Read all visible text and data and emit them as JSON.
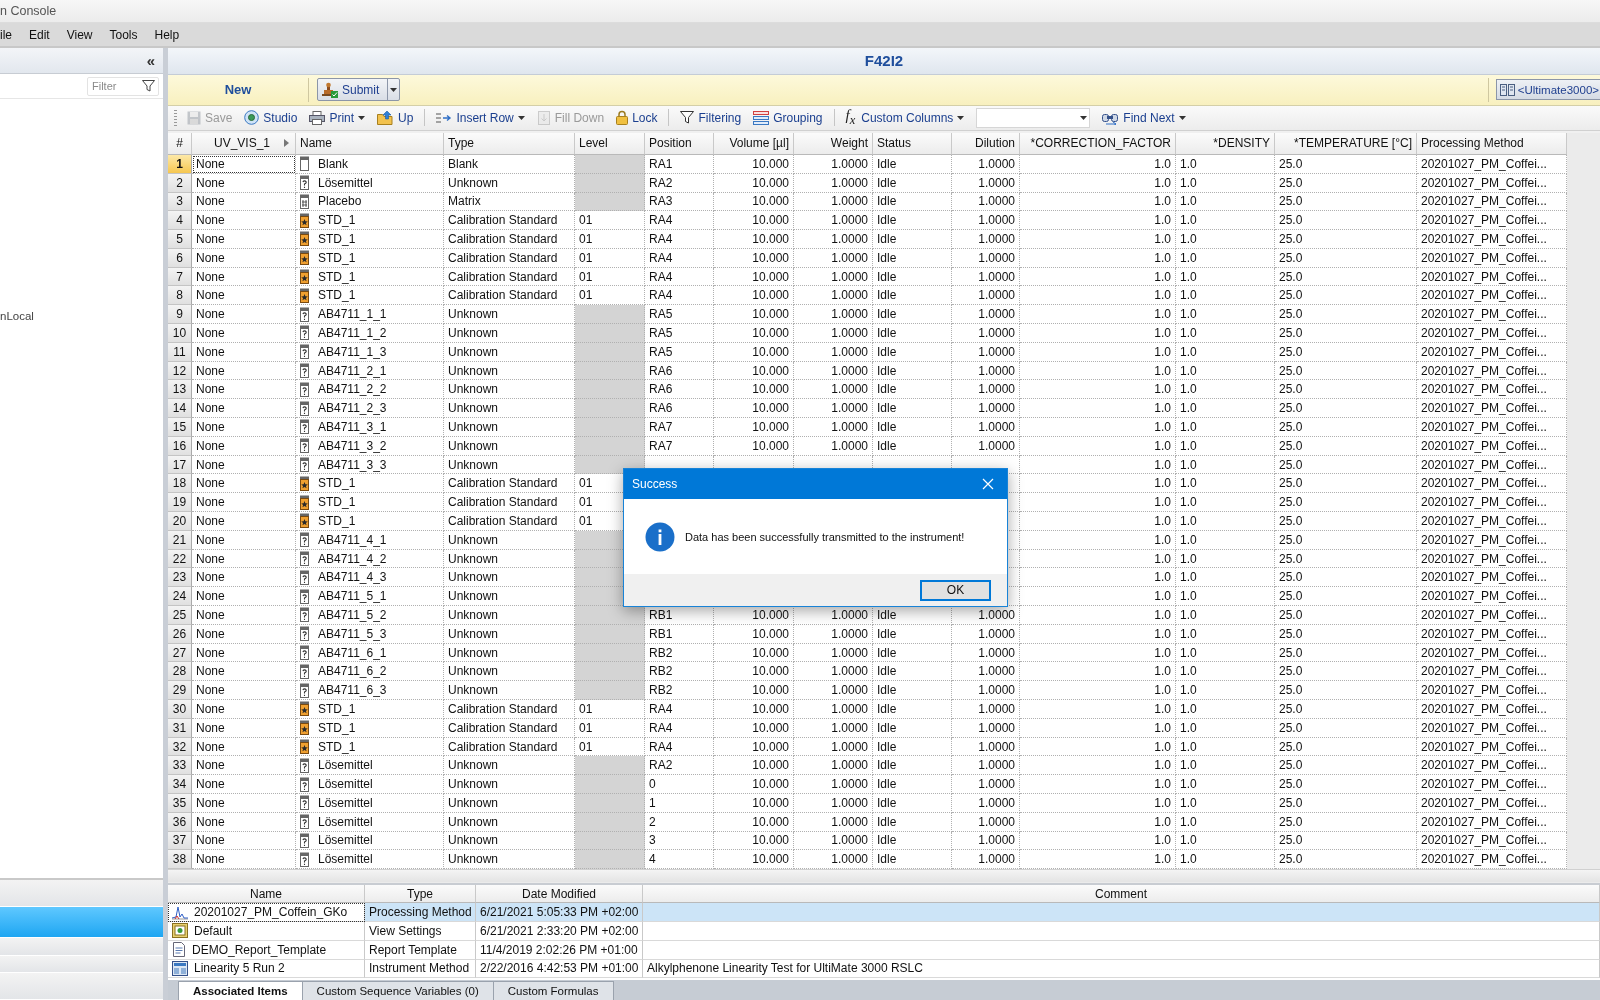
{
  "window": {
    "title": "n Console"
  },
  "menu": [
    "ile",
    "Edit",
    "View",
    "Tools",
    "Help"
  ],
  "sidebar": {
    "collapse": "«",
    "filter": {
      "placeholder": "Filter"
    },
    "items": [
      {
        "label": "nLocal"
      }
    ],
    "lower_items": [
      {
        "selected": false
      },
      {
        "selected": true
      },
      {
        "selected": false
      },
      {
        "selected": false
      },
      {
        "selected": false
      }
    ]
  },
  "document": {
    "title": "F42I2"
  },
  "action_bar": {
    "mode": "New",
    "submit": {
      "label": "Submit"
    },
    "instrument_button": {
      "label": "<Ultimate3000>"
    }
  },
  "toolbar": [
    {
      "label": "Save",
      "kind": "button",
      "disabled": true,
      "separator_before": false
    },
    {
      "label": "Studio",
      "kind": "button",
      "disabled": false,
      "separator_before": false
    },
    {
      "label": "Print",
      "kind": "dropdown",
      "disabled": false,
      "separator_before": false
    },
    {
      "label": "Up",
      "kind": "button",
      "disabled": false,
      "separator_before": false
    },
    {
      "label": "Insert Row",
      "kind": "dropdown",
      "disabled": false,
      "separator_before": true
    },
    {
      "label": "Fill Down",
      "kind": "button",
      "disabled": true,
      "separator_before": false
    },
    {
      "label": "Lock",
      "kind": "button",
      "disabled": false,
      "separator_before": false
    },
    {
      "label": "Filtering",
      "kind": "button",
      "disabled": false,
      "separator_before": true
    },
    {
      "label": "Grouping",
      "kind": "button",
      "disabled": false,
      "separator_before": false
    },
    {
      "label": "Custom Columns",
      "symbol": "f$_{x}$",
      "kind": "dropdown",
      "disabled": false,
      "separator_before": true
    },
    {
      "kind": "combo",
      "disabled": false,
      "separator_before": false
    },
    {
      "label": "Find Next",
      "kind": "dropdown",
      "disabled": false,
      "separator_before": false
    }
  ],
  "table": {
    "number_header": "#",
    "columns": [
      "UV_VIS_1",
      "Name",
      "Type",
      "Level",
      "Position",
      "Volume [µl]",
      "Weight",
      "Status",
      "Dilution",
      "*CORRECTION_FACTOR",
      "*DENSITY",
      "*TEMPERATURE [°C]",
      "Processing Method"
    ],
    "rows": [
      {
        "number": "1",
        "selected": true,
        "kind": "blank",
        "level_disabled": true,
        "cells": [
          "None",
          "Blank",
          "Blank",
          null,
          "RA1",
          "10.000",
          "1.0000",
          "Idle",
          "1.0000",
          "1.0",
          "1.0",
          "25.0",
          "20201027_PM_Coffei..."
        ]
      },
      {
        "number": "2",
        "selected": false,
        "kind": "unknown",
        "level_disabled": true,
        "cells": [
          "None",
          "Lösemittel",
          "Unknown",
          null,
          "RA2",
          "10.000",
          "1.0000",
          "Idle",
          "1.0000",
          "1.0",
          "1.0",
          "25.0",
          "20201027_PM_Coffei..."
        ]
      },
      {
        "number": "3",
        "selected": false,
        "kind": "matrix",
        "level_disabled": true,
        "cells": [
          "None",
          "Placebo",
          "Matrix",
          null,
          "RA3",
          "10.000",
          "1.0000",
          "Idle",
          "1.0000",
          "1.0",
          "1.0",
          "25.0",
          "20201027_PM_Coffei..."
        ]
      },
      {
        "number": "4",
        "selected": false,
        "kind": "standard",
        "level_disabled": false,
        "cells": [
          "None",
          "STD_1",
          "Calibration Standard",
          "01",
          "RA4",
          "10.000",
          "1.0000",
          "Idle",
          "1.0000",
          "1.0",
          "1.0",
          "25.0",
          "20201027_PM_Coffei..."
        ]
      },
      {
        "number": "5",
        "selected": false,
        "kind": "standard",
        "level_disabled": false,
        "cells": [
          "None",
          "STD_1",
          "Calibration Standard",
          "01",
          "RA4",
          "10.000",
          "1.0000",
          "Idle",
          "1.0000",
          "1.0",
          "1.0",
          "25.0",
          "20201027_PM_Coffei..."
        ]
      },
      {
        "number": "6",
        "selected": false,
        "kind": "standard",
        "level_disabled": false,
        "cells": [
          "None",
          "STD_1",
          "Calibration Standard",
          "01",
          "RA4",
          "10.000",
          "1.0000",
          "Idle",
          "1.0000",
          "1.0",
          "1.0",
          "25.0",
          "20201027_PM_Coffei..."
        ]
      },
      {
        "number": "7",
        "selected": false,
        "kind": "standard",
        "level_disabled": false,
        "cells": [
          "None",
          "STD_1",
          "Calibration Standard",
          "01",
          "RA4",
          "10.000",
          "1.0000",
          "Idle",
          "1.0000",
          "1.0",
          "1.0",
          "25.0",
          "20201027_PM_Coffei..."
        ]
      },
      {
        "number": "8",
        "selected": false,
        "kind": "standard",
        "level_disabled": false,
        "cells": [
          "None",
          "STD_1",
          "Calibration Standard",
          "01",
          "RA4",
          "10.000",
          "1.0000",
          "Idle",
          "1.0000",
          "1.0",
          "1.0",
          "25.0",
          "20201027_PM_Coffei..."
        ]
      },
      {
        "number": "9",
        "selected": false,
        "kind": "unknown",
        "level_disabled": true,
        "cells": [
          "None",
          "AB4711_1_1",
          "Unknown",
          null,
          "RA5",
          "10.000",
          "1.0000",
          "Idle",
          "1.0000",
          "1.0",
          "1.0",
          "25.0",
          "20201027_PM_Coffei..."
        ]
      },
      {
        "number": "10",
        "selected": false,
        "kind": "unknown",
        "level_disabled": true,
        "cells": [
          "None",
          "AB4711_1_2",
          "Unknown",
          null,
          "RA5",
          "10.000",
          "1.0000",
          "Idle",
          "1.0000",
          "1.0",
          "1.0",
          "25.0",
          "20201027_PM_Coffei..."
        ]
      },
      {
        "number": "11",
        "selected": false,
        "kind": "unknown",
        "level_disabled": true,
        "cells": [
          "None",
          "AB4711_1_3",
          "Unknown",
          null,
          "RA5",
          "10.000",
          "1.0000",
          "Idle",
          "1.0000",
          "1.0",
          "1.0",
          "25.0",
          "20201027_PM_Coffei..."
        ]
      },
      {
        "number": "12",
        "selected": false,
        "kind": "unknown",
        "level_disabled": true,
        "cells": [
          "None",
          "AB4711_2_1",
          "Unknown",
          null,
          "RA6",
          "10.000",
          "1.0000",
          "Idle",
          "1.0000",
          "1.0",
          "1.0",
          "25.0",
          "20201027_PM_Coffei..."
        ]
      },
      {
        "number": "13",
        "selected": false,
        "kind": "unknown",
        "level_disabled": true,
        "cells": [
          "None",
          "AB4711_2_2",
          "Unknown",
          null,
          "RA6",
          "10.000",
          "1.0000",
          "Idle",
          "1.0000",
          "1.0",
          "1.0",
          "25.0",
          "20201027_PM_Coffei..."
        ]
      },
      {
        "number": "14",
        "selected": false,
        "kind": "unknown",
        "level_disabled": true,
        "cells": [
          "None",
          "AB4711_2_3",
          "Unknown",
          null,
          "RA6",
          "10.000",
          "1.0000",
          "Idle",
          "1.0000",
          "1.0",
          "1.0",
          "25.0",
          "20201027_PM_Coffei..."
        ]
      },
      {
        "number": "15",
        "selected": false,
        "kind": "unknown",
        "level_disabled": true,
        "cells": [
          "None",
          "AB4711_3_1",
          "Unknown",
          null,
          "RA7",
          "10.000",
          "1.0000",
          "Idle",
          "1.0000",
          "1.0",
          "1.0",
          "25.0",
          "20201027_PM_Coffei..."
        ]
      },
      {
        "number": "16",
        "selected": false,
        "kind": "unknown",
        "level_disabled": true,
        "cells": [
          "None",
          "AB4711_3_2",
          "Unknown",
          null,
          "RA7",
          "10.000",
          "1.0000",
          "Idle",
          "1.0000",
          "1.0",
          "1.0",
          "25.0",
          "20201027_PM_Coffei..."
        ]
      },
      {
        "number": "17",
        "selected": false,
        "kind": "unknown",
        "level_disabled": true,
        "cells": [
          "None",
          "AB4711_3_3",
          "Unknown",
          null,
          null,
          null,
          null,
          null,
          null,
          "1.0",
          "1.0",
          "25.0",
          "20201027_PM_Coffei..."
        ]
      },
      {
        "number": "18",
        "selected": false,
        "kind": "standard",
        "level_disabled": false,
        "cells": [
          "None",
          "STD_1",
          "Calibration Standard",
          "01",
          null,
          null,
          null,
          null,
          null,
          "1.0",
          "1.0",
          "25.0",
          "20201027_PM_Coffei..."
        ]
      },
      {
        "number": "19",
        "selected": false,
        "kind": "standard",
        "level_disabled": false,
        "cells": [
          "None",
          "STD_1",
          "Calibration Standard",
          "01",
          null,
          null,
          null,
          null,
          null,
          "1.0",
          "1.0",
          "25.0",
          "20201027_PM_Coffei..."
        ]
      },
      {
        "number": "20",
        "selected": false,
        "kind": "standard",
        "level_disabled": false,
        "cells": [
          "None",
          "STD_1",
          "Calibration Standard",
          "01",
          null,
          null,
          null,
          null,
          null,
          "1.0",
          "1.0",
          "25.0",
          "20201027_PM_Coffei..."
        ]
      },
      {
        "number": "21",
        "selected": false,
        "kind": "unknown",
        "level_disabled": true,
        "cells": [
          "None",
          "AB4711_4_1",
          "Unknown",
          null,
          null,
          null,
          null,
          null,
          null,
          "1.0",
          "1.0",
          "25.0",
          "20201027_PM_Coffei..."
        ]
      },
      {
        "number": "22",
        "selected": false,
        "kind": "unknown",
        "level_disabled": true,
        "cells": [
          "None",
          "AB4711_4_2",
          "Unknown",
          null,
          null,
          null,
          null,
          null,
          null,
          "1.0",
          "1.0",
          "25.0",
          "20201027_PM_Coffei..."
        ]
      },
      {
        "number": "23",
        "selected": false,
        "kind": "unknown",
        "level_disabled": true,
        "cells": [
          "None",
          "AB4711_4_3",
          "Unknown",
          null,
          null,
          null,
          null,
          null,
          null,
          "1.0",
          "1.0",
          "25.0",
          "20201027_PM_Coffei..."
        ]
      },
      {
        "number": "24",
        "selected": false,
        "kind": "unknown",
        "level_disabled": true,
        "cells": [
          "None",
          "AB4711_5_1",
          "Unknown",
          null,
          null,
          null,
          null,
          null,
          null,
          "1.0",
          "1.0",
          "25.0",
          "20201027_PM_Coffei..."
        ]
      },
      {
        "number": "25",
        "selected": false,
        "kind": "unknown",
        "level_disabled": true,
        "cells": [
          "None",
          "AB4711_5_2",
          "Unknown",
          null,
          "RB1",
          "10.000",
          "1.0000",
          "Idle",
          "1.0000",
          "1.0",
          "1.0",
          "25.0",
          "20201027_PM_Coffei..."
        ]
      },
      {
        "number": "26",
        "selected": false,
        "kind": "unknown",
        "level_disabled": true,
        "cells": [
          "None",
          "AB4711_5_3",
          "Unknown",
          null,
          "RB1",
          "10.000",
          "1.0000",
          "Idle",
          "1.0000",
          "1.0",
          "1.0",
          "25.0",
          "20201027_PM_Coffei..."
        ]
      },
      {
        "number": "27",
        "selected": false,
        "kind": "unknown",
        "level_disabled": true,
        "cells": [
          "None",
          "AB4711_6_1",
          "Unknown",
          null,
          "RB2",
          "10.000",
          "1.0000",
          "Idle",
          "1.0000",
          "1.0",
          "1.0",
          "25.0",
          "20201027_PM_Coffei..."
        ]
      },
      {
        "number": "28",
        "selected": false,
        "kind": "unknown",
        "level_disabled": true,
        "cells": [
          "None",
          "AB4711_6_2",
          "Unknown",
          null,
          "RB2",
          "10.000",
          "1.0000",
          "Idle",
          "1.0000",
          "1.0",
          "1.0",
          "25.0",
          "20201027_PM_Coffei..."
        ]
      },
      {
        "number": "29",
        "selected": false,
        "kind": "unknown",
        "level_disabled": true,
        "cells": [
          "None",
          "AB4711_6_3",
          "Unknown",
          null,
          "RB2",
          "10.000",
          "1.0000",
          "Idle",
          "1.0000",
          "1.0",
          "1.0",
          "25.0",
          "20201027_PM_Coffei..."
        ]
      },
      {
        "number": "30",
        "selected": false,
        "kind": "standard",
        "level_disabled": false,
        "cells": [
          "None",
          "STD_1",
          "Calibration Standard",
          "01",
          "RA4",
          "10.000",
          "1.0000",
          "Idle",
          "1.0000",
          "1.0",
          "1.0",
          "25.0",
          "20201027_PM_Coffei..."
        ]
      },
      {
        "number": "31",
        "selected": false,
        "kind": "standard",
        "level_disabled": false,
        "cells": [
          "None",
          "STD_1",
          "Calibration Standard",
          "01",
          "RA4",
          "10.000",
          "1.0000",
          "Idle",
          "1.0000",
          "1.0",
          "1.0",
          "25.0",
          "20201027_PM_Coffei..."
        ]
      },
      {
        "number": "32",
        "selected": false,
        "kind": "standard",
        "level_disabled": false,
        "cells": [
          "None",
          "STD_1",
          "Calibration Standard",
          "01",
          "RA4",
          "10.000",
          "1.0000",
          "Idle",
          "1.0000",
          "1.0",
          "1.0",
          "25.0",
          "20201027_PM_Coffei..."
        ]
      },
      {
        "number": "33",
        "selected": false,
        "kind": "unknown",
        "level_disabled": true,
        "cells": [
          "None",
          "Lösemittel",
          "Unknown",
          null,
          "RA2",
          "10.000",
          "1.0000",
          "Idle",
          "1.0000",
          "1.0",
          "1.0",
          "25.0",
          "20201027_PM_Coffei..."
        ]
      },
      {
        "number": "34",
        "selected": false,
        "kind": "unknown",
        "level_disabled": true,
        "cells": [
          "None",
          "Lösemittel",
          "Unknown",
          null,
          "0",
          "10.000",
          "1.0000",
          "Idle",
          "1.0000",
          "1.0",
          "1.0",
          "25.0",
          "20201027_PM_Coffei..."
        ]
      },
      {
        "number": "35",
        "selected": false,
        "kind": "unknown",
        "level_disabled": true,
        "cells": [
          "None",
          "Lösemittel",
          "Unknown",
          null,
          "1",
          "10.000",
          "1.0000",
          "Idle",
          "1.0000",
          "1.0",
          "1.0",
          "25.0",
          "20201027_PM_Coffei..."
        ]
      },
      {
        "number": "36",
        "selected": false,
        "kind": "unknown",
        "level_disabled": true,
        "cells": [
          "None",
          "Lösemittel",
          "Unknown",
          null,
          "2",
          "10.000",
          "1.0000",
          "Idle",
          "1.0000",
          "1.0",
          "1.0",
          "25.0",
          "20201027_PM_Coffei..."
        ]
      },
      {
        "number": "37",
        "selected": false,
        "kind": "unknown",
        "level_disabled": true,
        "cells": [
          "None",
          "Lösemittel",
          "Unknown",
          null,
          "3",
          "10.000",
          "1.0000",
          "Idle",
          "1.0000",
          "1.0",
          "1.0",
          "25.0",
          "20201027_PM_Coffei..."
        ]
      },
      {
        "number": "38",
        "selected": false,
        "kind": "unknown",
        "level_disabled": true,
        "cells": [
          "None",
          "Lösemittel",
          "Unknown",
          null,
          "4",
          "10.000",
          "1.0000",
          "Idle",
          "1.0000",
          "1.0",
          "1.0",
          "25.0",
          "20201027_PM_Coffei..."
        ]
      }
    ]
  },
  "associated": {
    "columns": [
      "Name",
      "Type",
      "Date Modified",
      "Comment"
    ],
    "rows": [
      {
        "kind": "chromatogram",
        "selected": true,
        "cells": [
          "20201027_PM_Coffein_GKo",
          "Processing Method",
          "6/21/2021 5:05:33 PM +02:00",
          null
        ]
      },
      {
        "kind": "settings",
        "selected": false,
        "cells": [
          "Default",
          "View Settings",
          "6/21/2021 2:33:20 PM +02:00",
          null
        ]
      },
      {
        "kind": "report",
        "selected": false,
        "cells": [
          "DEMO_Report_Template",
          "Report Template",
          "11/4/2019 2:02:26 PM +01:00",
          null
        ]
      },
      {
        "kind": "instrument",
        "selected": false,
        "cells": [
          "Linearity 5 Run 2",
          "Instrument Method",
          "2/22/2016 4:42:53 PM +01:00",
          "Alkylphenone Linearity Test for UltiMate 3000 RSLC"
        ]
      }
    ]
  },
  "bottom_tabs": [
    {
      "label": "Associated Items",
      "selected": true
    },
    {
      "label": "Custom Sequence Variables (0)",
      "selected": false
    },
    {
      "label": "Custom Formulas",
      "selected": false
    }
  ],
  "dialog": {
    "title": "Success",
    "message": "Data has been successfully transmitted to the instrument!",
    "buttons": [
      "OK"
    ]
  }
}
